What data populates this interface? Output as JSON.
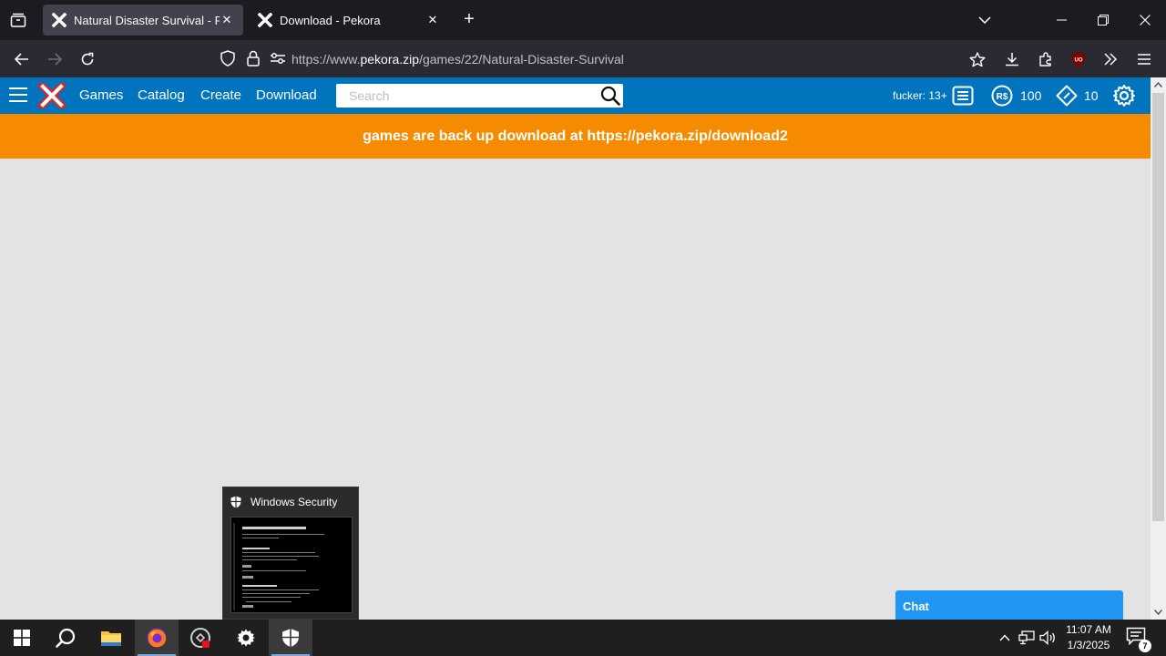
{
  "browser": {
    "tabs": [
      {
        "label": "Natural Disaster Survival - Proje",
        "active": true
      },
      {
        "label": "Download - Pekora",
        "active": false
      }
    ],
    "url_prefix": "https://www.",
    "url_host": "pekora.zip",
    "url_path": "/games/22/Natural-Disaster-Survival",
    "toolbar_icons": [
      "back-icon",
      "forward-icon",
      "reload-icon",
      "shield-icon",
      "lock-icon",
      "permissions-icon",
      "bookmark-star-icon",
      "downloads-icon",
      "extensions-icon",
      "ublock-icon",
      "overflow-icon",
      "menu-icon"
    ],
    "extension_badge": "UO"
  },
  "site": {
    "nav": [
      "Games",
      "Catalog",
      "Create",
      "Download"
    ],
    "search_placeholder": "Search",
    "username": "fucker: 13+",
    "robux_label": "R$",
    "robux": "100",
    "tickets": "10",
    "banner": "games are back up download at https://pekora.zip/download2",
    "chat": "Chat",
    "colors": {
      "header": "#0074bd",
      "banner": "#f68b00",
      "chat": "#2196f3",
      "page_bg": "#e3e3e3"
    }
  },
  "preview": {
    "title": "Windows Security"
  },
  "taskbar": {
    "apps": [
      "windows-start-icon",
      "search-icon",
      "file-explorer-icon",
      "firefox-icon",
      "roblox-studio-icon",
      "settings-icon",
      "windows-security-icon"
    ],
    "time": "11:07 AM",
    "date": "1/3/2025",
    "notification_count": "7"
  }
}
